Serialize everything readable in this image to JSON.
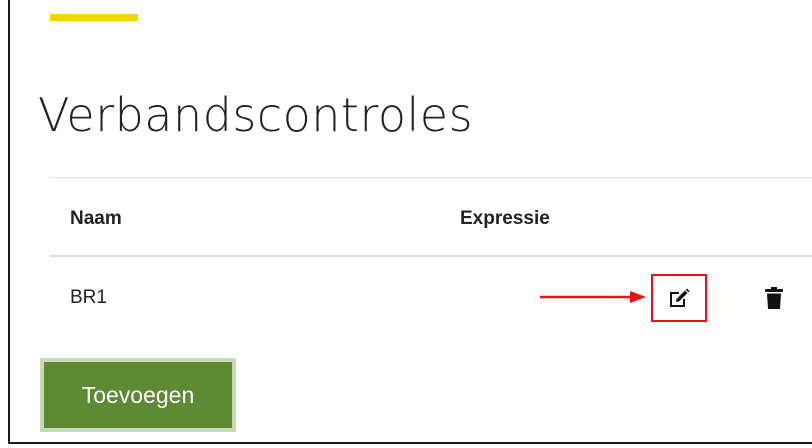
{
  "page": {
    "title": "Verbandscontroles"
  },
  "table": {
    "columns": [
      "Naam",
      "Expressie"
    ],
    "rows": [
      {
        "name": "BR1",
        "expression": ""
      }
    ]
  },
  "actions": {
    "add_label": "Toevoegen"
  },
  "colors": {
    "accent_bar": "#f5d400",
    "button_green": "#5f8a34",
    "highlight_red": "#e8121a"
  },
  "icons": {
    "edit": "edit-icon",
    "delete": "trash-icon",
    "annotation": "arrow-right-icon"
  }
}
